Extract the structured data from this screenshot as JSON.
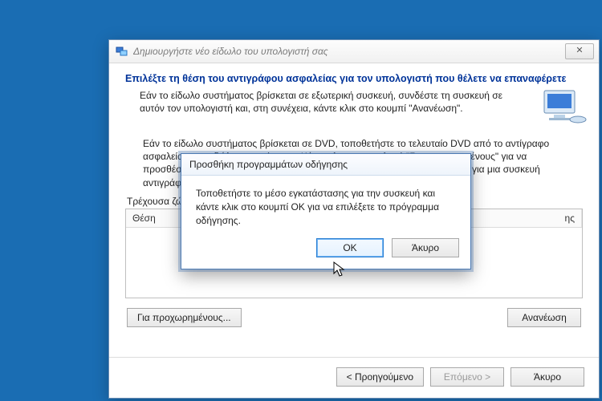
{
  "wizard": {
    "title": "Δημιουργήστε νέο είδωλο του υπολογιστή σας",
    "heading": "Επιλέξτε τη θέση του αντιγράφου ασφαλείας για τον υπολογιστή που θέλετε να επαναφέρετε",
    "intro": "Εάν το είδωλο συστήματος βρίσκεται σε εξωτερική συσκευή, συνδέστε τη συσκευή σε αυτόν τον υπολογιστή και, στη συνέχεια, κάντε κλικ στο κουμπί \"Ανανέωση\".",
    "dvd_text": "Εάν το είδωλο συστήματος βρίσκεται σε DVD, τοποθετήστε το τελευταίο DVD από το αντίγραφο ασφαλείας του ειδώλου συστήματος. Κάντε κλικ στην επιλογή \"Για προχωρημένους\" για να προσθέσετε μια θέση δικτύου ή να εγκαταστήσετε ένα πρόγραμμα οδήγησης για μια συσκευή αντιγράφων ασφαλείας, εάν δεν εμφανίζεται στην παρακάτω λίστα.",
    "current_zone_label": "Τρέχουσα ζώνη ώρας:",
    "columns": {
      "location": "Θέση",
      "rest": "ης"
    },
    "buttons": {
      "advanced": "Για προχωρημένους...",
      "refresh": "Ανανέωση",
      "back": "< Προηγούμενο",
      "next": "Επόμενο >",
      "cancel": "Άκυρο"
    }
  },
  "modal": {
    "title": "Προσθήκη προγραμμάτων οδήγησης",
    "body": "Τοποθετήστε το μέσο εγκατάστασης για την συσκευή και κάντε κλικ στο κουμπί OK για να επιλέξετε το πρόγραμμα οδήγησης.",
    "ok": "OK",
    "cancel": "Άκυρο"
  }
}
